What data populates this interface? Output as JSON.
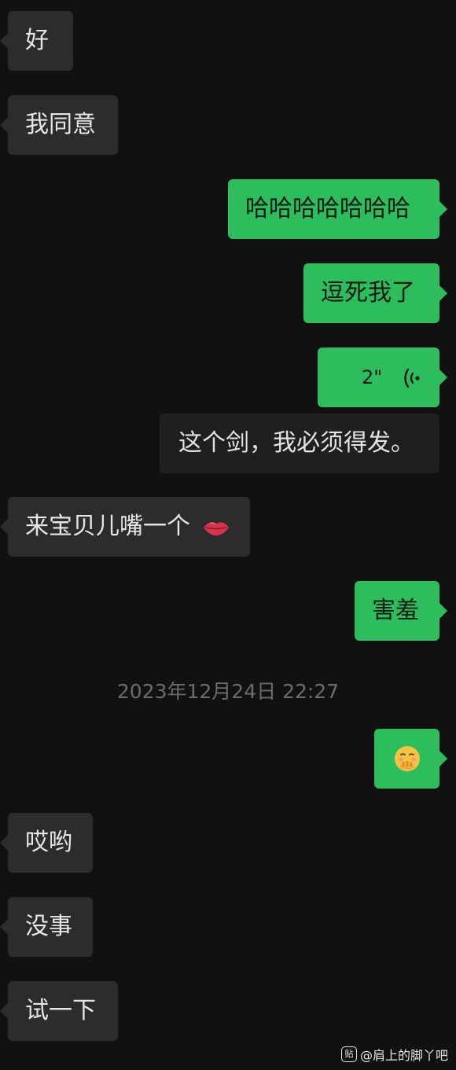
{
  "messages": [
    {
      "id": "m1",
      "side": "in",
      "text": "好"
    },
    {
      "id": "m2",
      "side": "in",
      "text": "我同意"
    },
    {
      "id": "m3",
      "side": "out",
      "text": "哈哈哈哈哈哈哈"
    },
    {
      "id": "m4",
      "side": "out",
      "text": "逗死我了"
    },
    {
      "id": "m5",
      "side": "out",
      "type": "voice",
      "duration": "2\""
    },
    {
      "id": "m6",
      "side": "out",
      "type": "voice-transcript",
      "text": "这个剑，我必须得发。"
    },
    {
      "id": "m7",
      "side": "in",
      "text": "来宝贝儿嘴一个",
      "emoji": "lips-icon"
    },
    {
      "id": "m8",
      "side": "out",
      "text": "害羞"
    },
    {
      "id": "m9",
      "side": "out",
      "type": "emoji",
      "emoji": "face-with-hand-over-mouth-icon"
    },
    {
      "id": "m10",
      "side": "in",
      "text": "哎哟"
    },
    {
      "id": "m11",
      "side": "in",
      "text": "没事"
    },
    {
      "id": "m12",
      "side": "in",
      "text": "试一下"
    }
  ],
  "timestamp": "2023年12月24日 22:27",
  "watermark": {
    "text": "@肩上的脚丫吧",
    "logo": "贴"
  },
  "colors": {
    "background": "#111111",
    "incoming_bubble": "#2c2c2c",
    "outgoing_bubble": "#2dbd5d",
    "timestamp": "#6c6c6c"
  }
}
